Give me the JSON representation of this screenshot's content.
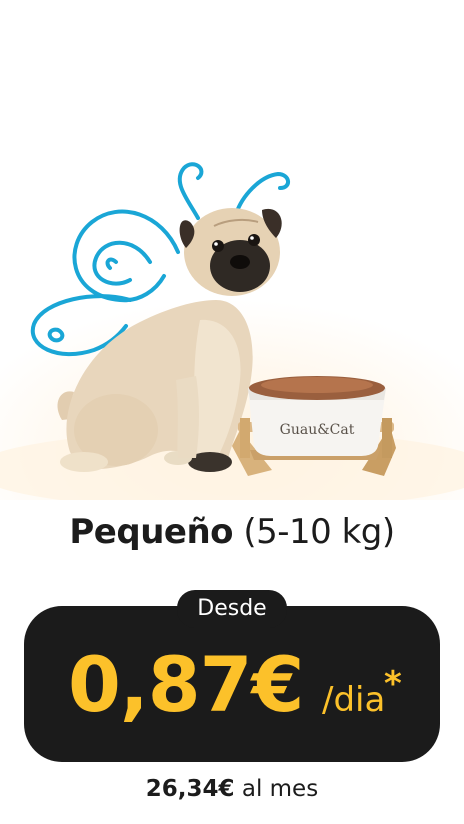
{
  "product": {
    "size_name": "Pequeño",
    "size_range": "(5-10 kg)",
    "bowl_brand": "Guau&Cat"
  },
  "pricing": {
    "badge_label": "Desde",
    "daily_price": "0,87€",
    "per_unit": "/dia",
    "asterisk": "*",
    "monthly_amount": "26,34€",
    "monthly_suffix": "al mes"
  },
  "colors": {
    "accent": "#fcc12a",
    "card_bg": "#1b1b1b",
    "doodle": "#1aa6d6"
  },
  "icons": [
    "butterfly-wings-doodle",
    "pug-dog-photo",
    "food-bowl-photo"
  ]
}
